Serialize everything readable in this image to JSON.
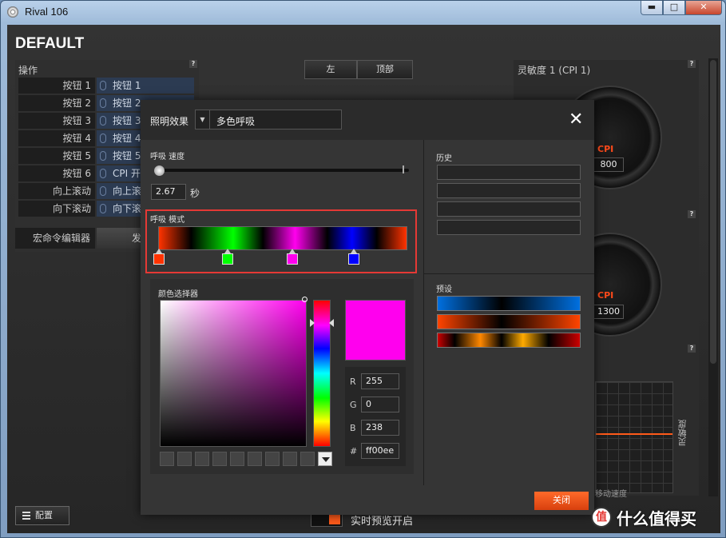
{
  "window": {
    "title": "Rival 106",
    "min_glyph": "▬",
    "max_glyph": "□",
    "close_glyph": "✕"
  },
  "profile": {
    "name": "DEFAULT"
  },
  "left_panel": {
    "label": "操作",
    "help": "?",
    "rows": [
      {
        "label": "按钮 1",
        "value": "按钮 1"
      },
      {
        "label": "按钮 2",
        "value": "按钮 2"
      },
      {
        "label": "按钮 3",
        "value": "按钮 3"
      },
      {
        "label": "按钮 4",
        "value": "按钮 4"
      },
      {
        "label": "按钮 5",
        "value": "按钮 5"
      },
      {
        "label": "按钮 6",
        "value": "CPI 开"
      },
      {
        "label": "向上滚动",
        "value": "向上滚"
      },
      {
        "label": "向下滚动",
        "value": "向下滚"
      }
    ],
    "macro_label": "宏命令编辑器",
    "macro_button": "发"
  },
  "segments": {
    "left": "左",
    "top": "顶部"
  },
  "right_panel": {
    "label": "灵敏度 1 (CPI 1)",
    "help": "?",
    "dial1": {
      "cpi_label": "CPI",
      "value": "800"
    },
    "dial2": {
      "cpi_label": "CPI",
      "value": "1300"
    },
    "graph_y_label": "灵敏度",
    "graph_x_label": "移动速度"
  },
  "bottom": {
    "config_label": "配置",
    "preview_label": "实时预览开启"
  },
  "modal": {
    "effect_label": "照明效果",
    "effect_value": "多色呼吸",
    "close_x": "✕",
    "speed_label": "呼吸 速度",
    "speed_value": "2.67",
    "speed_unit": "秒",
    "speed_fraction": 0.0,
    "mode_label": "呼吸 模式",
    "stops": [
      {
        "color": "#ff3300",
        "position": 0.0
      },
      {
        "color": "#00ff00",
        "position": 0.28
      },
      {
        "color": "#ff00ee",
        "position": 0.54
      },
      {
        "color": "#0000ff",
        "position": 0.79
      }
    ],
    "picker_label": "颜色选择器",
    "selected_color": "#ff00ee",
    "rgb": {
      "r_label": "R",
      "r": "255",
      "g_label": "G",
      "g": "0",
      "b_label": "B",
      "b": "238",
      "hex_label": "#",
      "hex": "ff00ee"
    },
    "history_label": "历史",
    "presets_label": "预设",
    "close_button": "关闭"
  },
  "watermark": {
    "badge": "值",
    "text": "什么值得买"
  },
  "colors": {
    "accent": "#ff5a1a",
    "highlight_box": "#e53935",
    "button_bg": "#2c3b52"
  }
}
